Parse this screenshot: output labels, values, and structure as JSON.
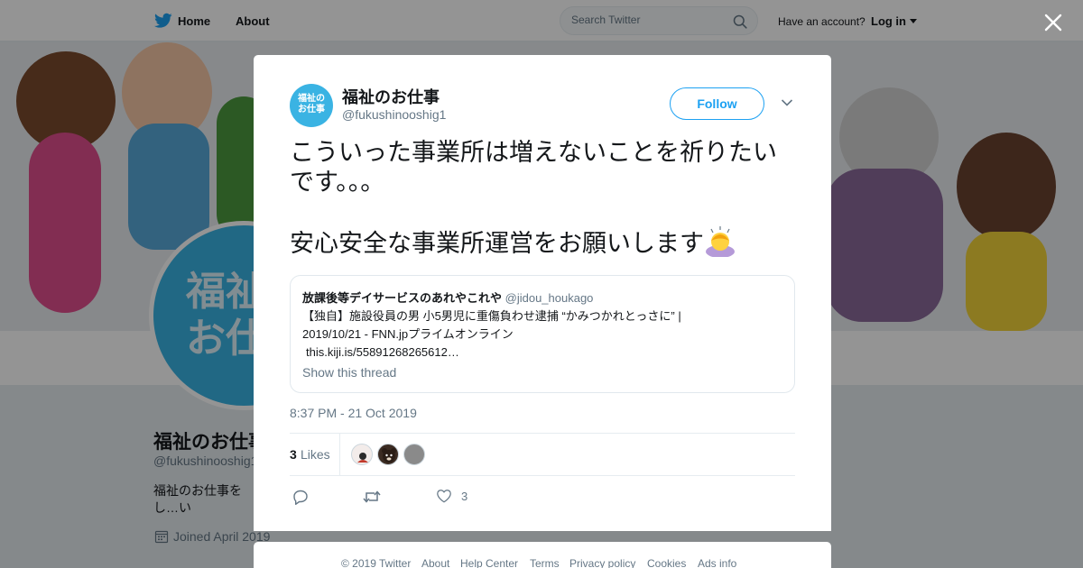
{
  "nav": {
    "home_label": "Home",
    "about_label": "About",
    "search_placeholder": "Search Twitter",
    "have_account": "Have an account?",
    "login_label": "Log in"
  },
  "background_profile": {
    "avatar_text": "福祉の\nお仕事",
    "name": "福祉のお仕事",
    "handle": "@fukushinooshig1",
    "bio": "福祉のお仕事をし…い",
    "joined": "Joined April 2019"
  },
  "tweet": {
    "avatar_text_line1": "福祉の",
    "avatar_text_line2": "お仕事",
    "author_name": "福祉のお仕事",
    "author_handle": "@fukushinooshig1",
    "follow_label": "Follow",
    "text_line1": "こういった事業所は増えないことを祈りたいです。。。",
    "text_line2": "安心安全な事業所運営をお願いします",
    "emoji": "woman-bowing-emoji",
    "quote": {
      "author_name": "放課後等デイサービスのあれやこれや",
      "author_handle": "@jidou_houkago",
      "line1": "【独自】施設役員の男 小5男児に重傷負わせ逮捕 “かみつかれとっさに” |",
      "line2": "2019/10/21 - FNN.jpプライムオンライン",
      "line3": "this.kiji.is/55891268265612…",
      "show_thread": "Show this thread"
    },
    "timestamp": "8:37 PM - 21 Oct 2019",
    "likes_count": "3",
    "likes_label": "Likes",
    "like_action_count": "3"
  },
  "footer": {
    "copyright": "© 2019 Twitter",
    "about": "About",
    "help": "Help Center",
    "terms": "Terms",
    "privacy": "Privacy policy",
    "cookies": "Cookies",
    "ads": "Ads info"
  },
  "colors": {
    "accent": "#1da1f2",
    "avatar_bg": "#3ab3e3",
    "muted_text": "#657786"
  }
}
